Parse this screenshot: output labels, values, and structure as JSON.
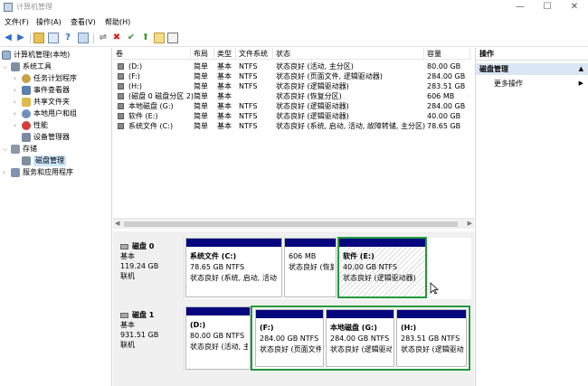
{
  "window": {
    "title": "计算机管理",
    "minimize": "—",
    "maximize": "☐",
    "close": "✕"
  },
  "menu": [
    "文件(F)",
    "操作(A)",
    "查看(V)",
    "帮助(H)"
  ],
  "toolbar": [
    "back-icon",
    "forward-icon",
    "folder-icon",
    "properties-icon",
    "help-icon",
    "view-icon",
    "connect-icon",
    "delete-icon",
    "check-icon",
    "export-icon",
    "list-icon",
    "more-icon"
  ],
  "tree": {
    "root": "计算机管理(本地)",
    "items": [
      {
        "label": "系统工具"
      },
      {
        "label": "任务计划程序"
      },
      {
        "label": "事件查看器"
      },
      {
        "label": "共享文件夹"
      },
      {
        "label": "本地用户和组"
      },
      {
        "label": "性能"
      },
      {
        "label": "设备管理器"
      },
      {
        "label": "存储"
      },
      {
        "label": "磁盘管理"
      },
      {
        "label": "服务和应用程序"
      }
    ]
  },
  "volumes": {
    "headers": [
      "卷",
      "布局",
      "类型",
      "文件系统",
      "状态",
      "容量"
    ],
    "rows": [
      {
        "name": "(D:)",
        "layout": "简单",
        "type": "基本",
        "fs": "NTFS",
        "status": "状态良好 (活动, 主分区)",
        "size": "80.00 GB"
      },
      {
        "name": "(F:)",
        "layout": "简单",
        "type": "基本",
        "fs": "NTFS",
        "status": "状态良好 (页面文件, 逻辑驱动器)",
        "size": "284.00 GB"
      },
      {
        "name": "(H:)",
        "layout": "简单",
        "type": "基本",
        "fs": "NTFS",
        "status": "状态良好 (逻辑驱动器)",
        "size": "283.51 GB"
      },
      {
        "name": "(磁盘 0 磁盘分区 2)",
        "layout": "简单",
        "type": "基本",
        "fs": "",
        "status": "状态良好 (恢复分区)",
        "size": "606 MB"
      },
      {
        "name": "本地磁盘 (G:)",
        "layout": "简单",
        "type": "基本",
        "fs": "NTFS",
        "status": "状态良好 (逻辑驱动器)",
        "size": "284.00 GB"
      },
      {
        "name": "软件 (E:)",
        "layout": "简单",
        "type": "基本",
        "fs": "NTFS",
        "status": "状态良好 (逻辑驱动器)",
        "size": "40.00 GB"
      },
      {
        "name": "系统文件 (C:)",
        "layout": "简单",
        "type": "基本",
        "fs": "NTFS",
        "status": "状态良好 (系统, 启动, 活动, 故障转储, 主分区)",
        "size": "78.65 GB"
      }
    ]
  },
  "disks": [
    {
      "name": "磁盘 0",
      "type": "基本",
      "size": "119.24 GB",
      "state": "联机",
      "partitions": [
        {
          "name": "系统文件  (C:)",
          "size": "78.65 GB NTFS",
          "status": "状态良好 (系统, 启动, 活动"
        },
        {
          "name": "",
          "size": "606 MB",
          "status": "状态良好 (恢复分区)"
        },
        {
          "name": "软件  (E:)",
          "size": "40.00 GB NTFS",
          "status": "状态良好 (逻辑驱动器)"
        }
      ]
    },
    {
      "name": "磁盘 1",
      "type": "基本",
      "size": "931.51 GB",
      "state": "联机",
      "partitions": [
        {
          "name": "(D:)",
          "size": "80.00 GB NTFS",
          "status": "状态良好 (活动, 主分区)"
        },
        {
          "name": "(F:)",
          "size": "284.00 GB NTFS",
          "status": "状态良好 (页面文件"
        },
        {
          "name": "本地磁盘  (G:)",
          "size": "284.00 GB NTFS",
          "status": "状态良好 (逻辑驱动器)"
        },
        {
          "name": "(H:)",
          "size": "283.51 GB NTFS",
          "status": "状态良好 (逻辑驱动器)"
        }
      ]
    }
  ],
  "actions": {
    "header": "操作",
    "section": "磁盘管理",
    "more": "更多操作"
  },
  "colors": {
    "partition_bar": "#06077f",
    "selection_outline": "#1f9a3c",
    "section_bg": "#dbe6f4",
    "tree_selected": "#cce8ff"
  }
}
